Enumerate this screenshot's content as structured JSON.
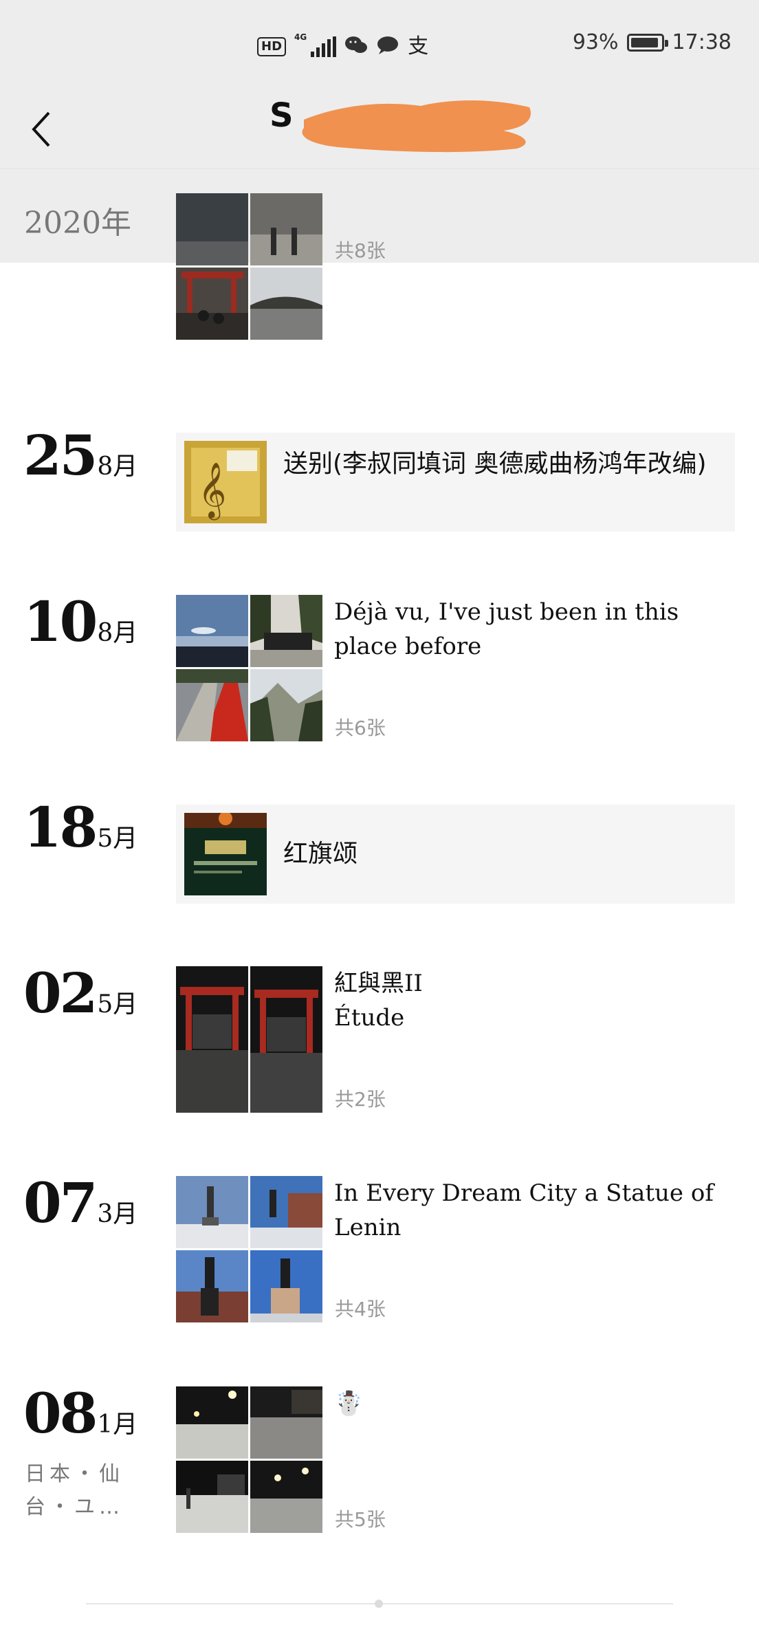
{
  "status_bar": {
    "hd": "HD",
    "network": "4G",
    "battery_percent": "93%",
    "battery_level": 0.93,
    "time": "17:38",
    "icons": [
      "wechat-icon",
      "chat-bubble-icon",
      "alipay-icon"
    ]
  },
  "nav": {
    "back_icon": "chevron-left-icon",
    "title_visible": "S"
  },
  "year": "2020年",
  "entries": [
    {
      "count": "共8张"
    },
    {
      "day": "25",
      "month": "8月",
      "music_title": "送别(李叔同填词 奥德威曲杨鸿年改编)"
    },
    {
      "day": "10",
      "month": "8月",
      "caption": "Déjà vu, I've just been in this place before",
      "count": "共6张"
    },
    {
      "day": "18",
      "month": "5月",
      "music_title": "红旗颂"
    },
    {
      "day": "02",
      "month": "5月",
      "caption_line1": "紅與黑II",
      "caption_line2": "Étude",
      "count": "共2张"
    },
    {
      "day": "07",
      "month": "3月",
      "caption": "In Every Dream City a Statue of Lenin",
      "count": "共4张"
    },
    {
      "day": "08",
      "month": "1月",
      "location": "日本・仙台・ユ…",
      "caption": "☃️",
      "count": "共5张"
    }
  ]
}
